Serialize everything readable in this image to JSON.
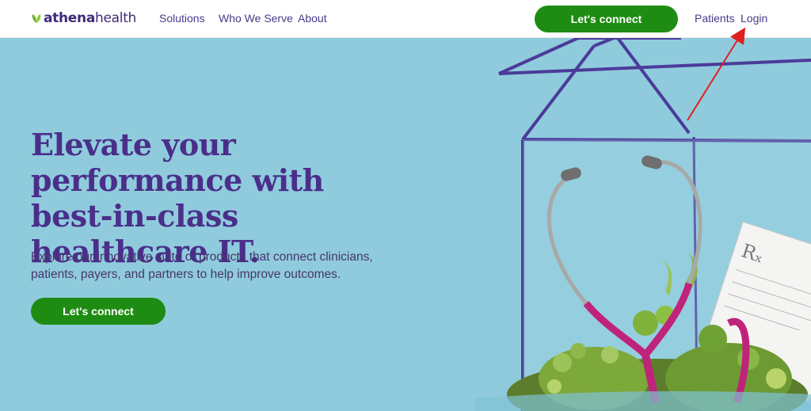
{
  "header": {
    "logo": {
      "bold": "athena",
      "light": "health"
    },
    "nav": [
      "Solutions",
      "Who We Serve",
      "About"
    ],
    "cta_label": "Let's connect",
    "utility_links": [
      "Patients",
      "Login"
    ]
  },
  "hero": {
    "title": "Elevate your performance with best-in-class healthcare IT.",
    "subtitle": "Explore our innovative suite of products that connect clinicians, patients, payers, and partners to help improve outcomes.",
    "cta_label": "Let's connect"
  },
  "illustration": {
    "prescription_mark": "Rₓ"
  },
  "icons": [
    "logo-leaf-icon",
    "annotation-arrow-icon"
  ],
  "colors": {
    "brand_green": "#1e8c12",
    "brand_purple": "#4a2e8a",
    "hero_background": "#8fcbdc",
    "annotation_red": "#e02020"
  }
}
